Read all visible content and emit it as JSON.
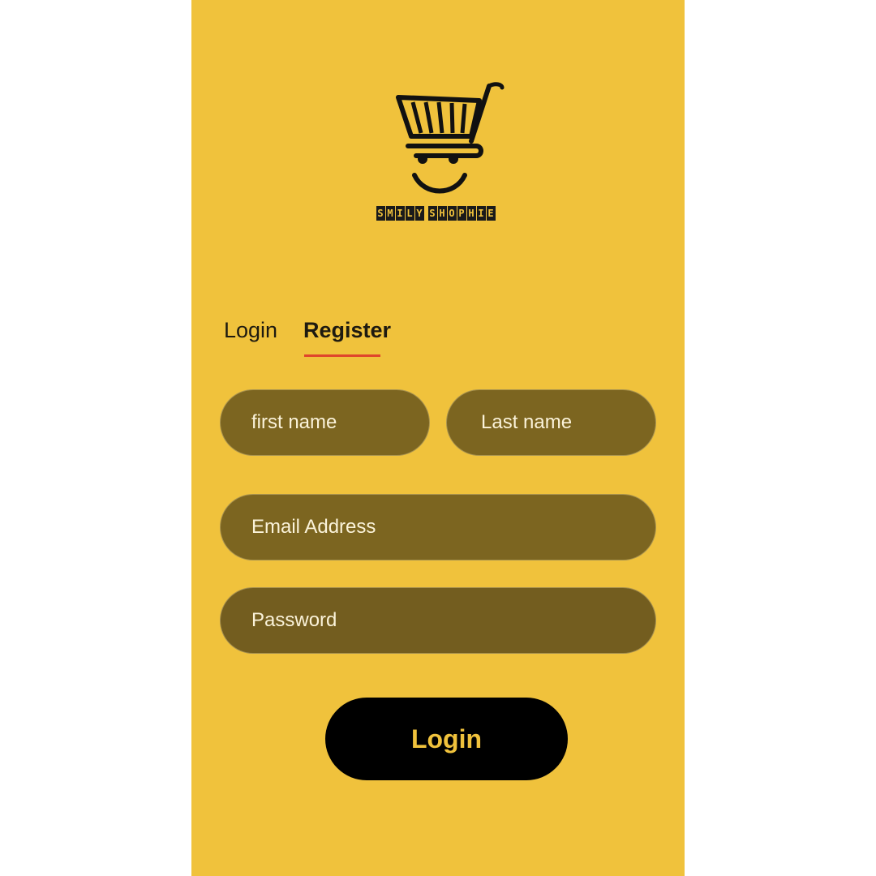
{
  "app": {
    "brand_name": "SMILY SHOPHIE",
    "logo_icon": "shopping-cart-smiley-icon"
  },
  "tabs": [
    {
      "label": "Login",
      "active": false
    },
    {
      "label": "Register",
      "active": true
    }
  ],
  "form": {
    "first_name_placeholder": "first name",
    "last_name_placeholder": "Last name",
    "email_placeholder": "Email Address",
    "password_placeholder": "Password"
  },
  "submit_label": "Login",
  "colors": {
    "background": "#F0C23C",
    "field_fill": "#7C6520",
    "tab_underline": "#E0452B",
    "button_fill": "#000000",
    "button_text": "#F0C23C"
  }
}
